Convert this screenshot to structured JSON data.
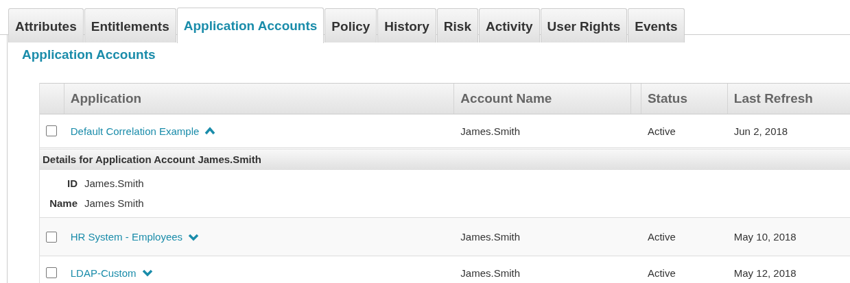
{
  "tabs": [
    {
      "label": "Attributes",
      "selected": false
    },
    {
      "label": "Entitlements",
      "selected": false
    },
    {
      "label": "Application Accounts",
      "selected": true
    },
    {
      "label": "Policy",
      "selected": false
    },
    {
      "label": "History",
      "selected": false
    },
    {
      "label": "Risk",
      "selected": false
    },
    {
      "label": "Activity",
      "selected": false
    },
    {
      "label": "User Rights",
      "selected": false
    },
    {
      "label": "Events",
      "selected": false
    }
  ],
  "section_title": "Application Accounts",
  "table": {
    "columns": [
      "Application",
      "Account Name",
      "Status",
      "Last Refresh"
    ],
    "rows": [
      {
        "application": "Default Correlation Example",
        "account_name": "James.Smith",
        "status": "Active",
        "last_refresh": "Jun 2, 2018",
        "checked": false,
        "expanded": true,
        "details": {
          "title": "Details for Application Account James.Smith",
          "fields": [
            {
              "label": "ID",
              "value": "James.Smith"
            },
            {
              "label": "Name",
              "value": "James Smith"
            }
          ]
        }
      },
      {
        "application": "HR System - Employees",
        "account_name": "James.Smith",
        "status": "Active",
        "last_refresh": "May 10, 2018",
        "checked": false,
        "expanded": false
      },
      {
        "application": "LDAP-Custom",
        "account_name": "James.Smith",
        "status": "Active",
        "last_refresh": "May 12, 2018",
        "checked": false,
        "expanded": false
      }
    ]
  }
}
